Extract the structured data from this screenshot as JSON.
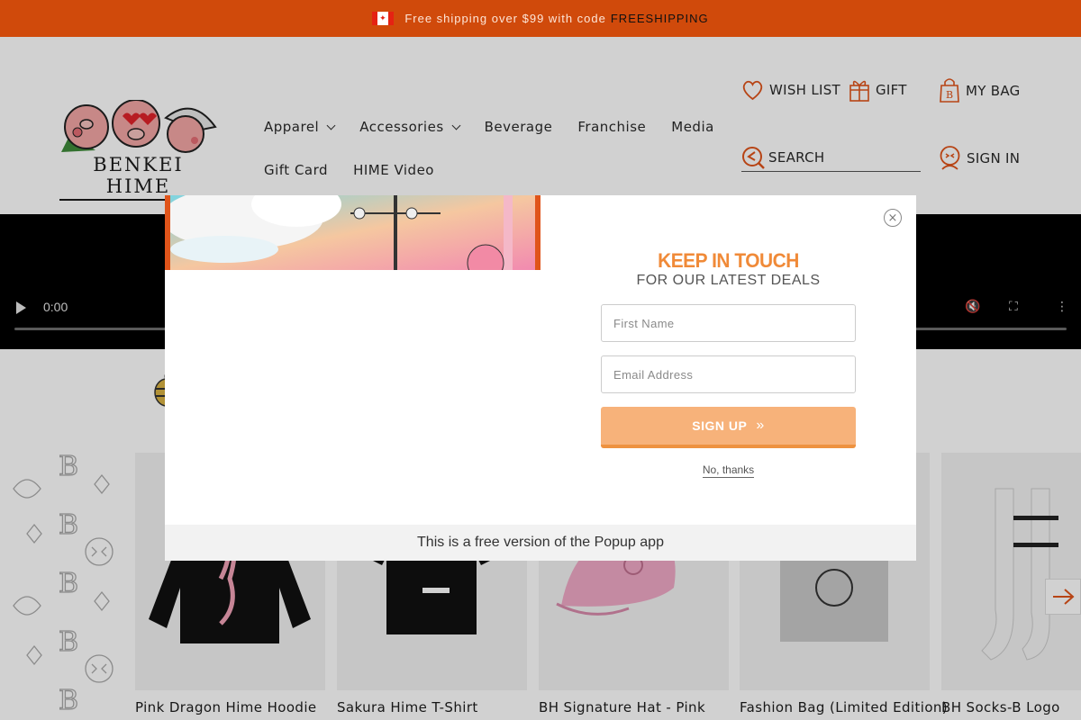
{
  "announcement": {
    "flag_icon": "canada-flag-icon",
    "text": "Free shipping over $99 with code",
    "code": "FREESHIPPING",
    "bg_color": "#d04a0b"
  },
  "brand": {
    "name": "BENKEI HIME"
  },
  "nav": {
    "row1": [
      {
        "label": "Apparel",
        "has_dropdown": true
      },
      {
        "label": "Accessories",
        "has_dropdown": true
      },
      {
        "label": "Beverage",
        "has_dropdown": false
      },
      {
        "label": "Franchise",
        "has_dropdown": false
      },
      {
        "label": "Media",
        "has_dropdown": false
      }
    ],
    "row2": [
      {
        "label": "Gift Card"
      },
      {
        "label": "HIME Video"
      }
    ]
  },
  "header_links": {
    "wishlist": "WISH LIST",
    "gift": "GIFT",
    "bag": "MY BAG",
    "search": "SEARCH",
    "signin": "SIGN IN"
  },
  "video": {
    "time": "0:00"
  },
  "products": [
    {
      "title": "Pink Dragon Hime Hoodie"
    },
    {
      "title": "Sakura Hime T-Shirt"
    },
    {
      "title": "BH Signature Hat - Pink"
    },
    {
      "title": "Fashion Bag (Limited Edition)"
    },
    {
      "title": "BH Socks-B Logo"
    }
  ],
  "popup": {
    "heading": "KEEP IN TOUCH",
    "subheading": "FOR OUR LATEST DEALS",
    "first_name_placeholder": "First Name",
    "email_placeholder": "Email Address",
    "signup_label": "SIGN UP",
    "no_thanks": "No, thanks",
    "footer": "This is a free version of the Popup app",
    "accent_color": "#f08a38"
  }
}
